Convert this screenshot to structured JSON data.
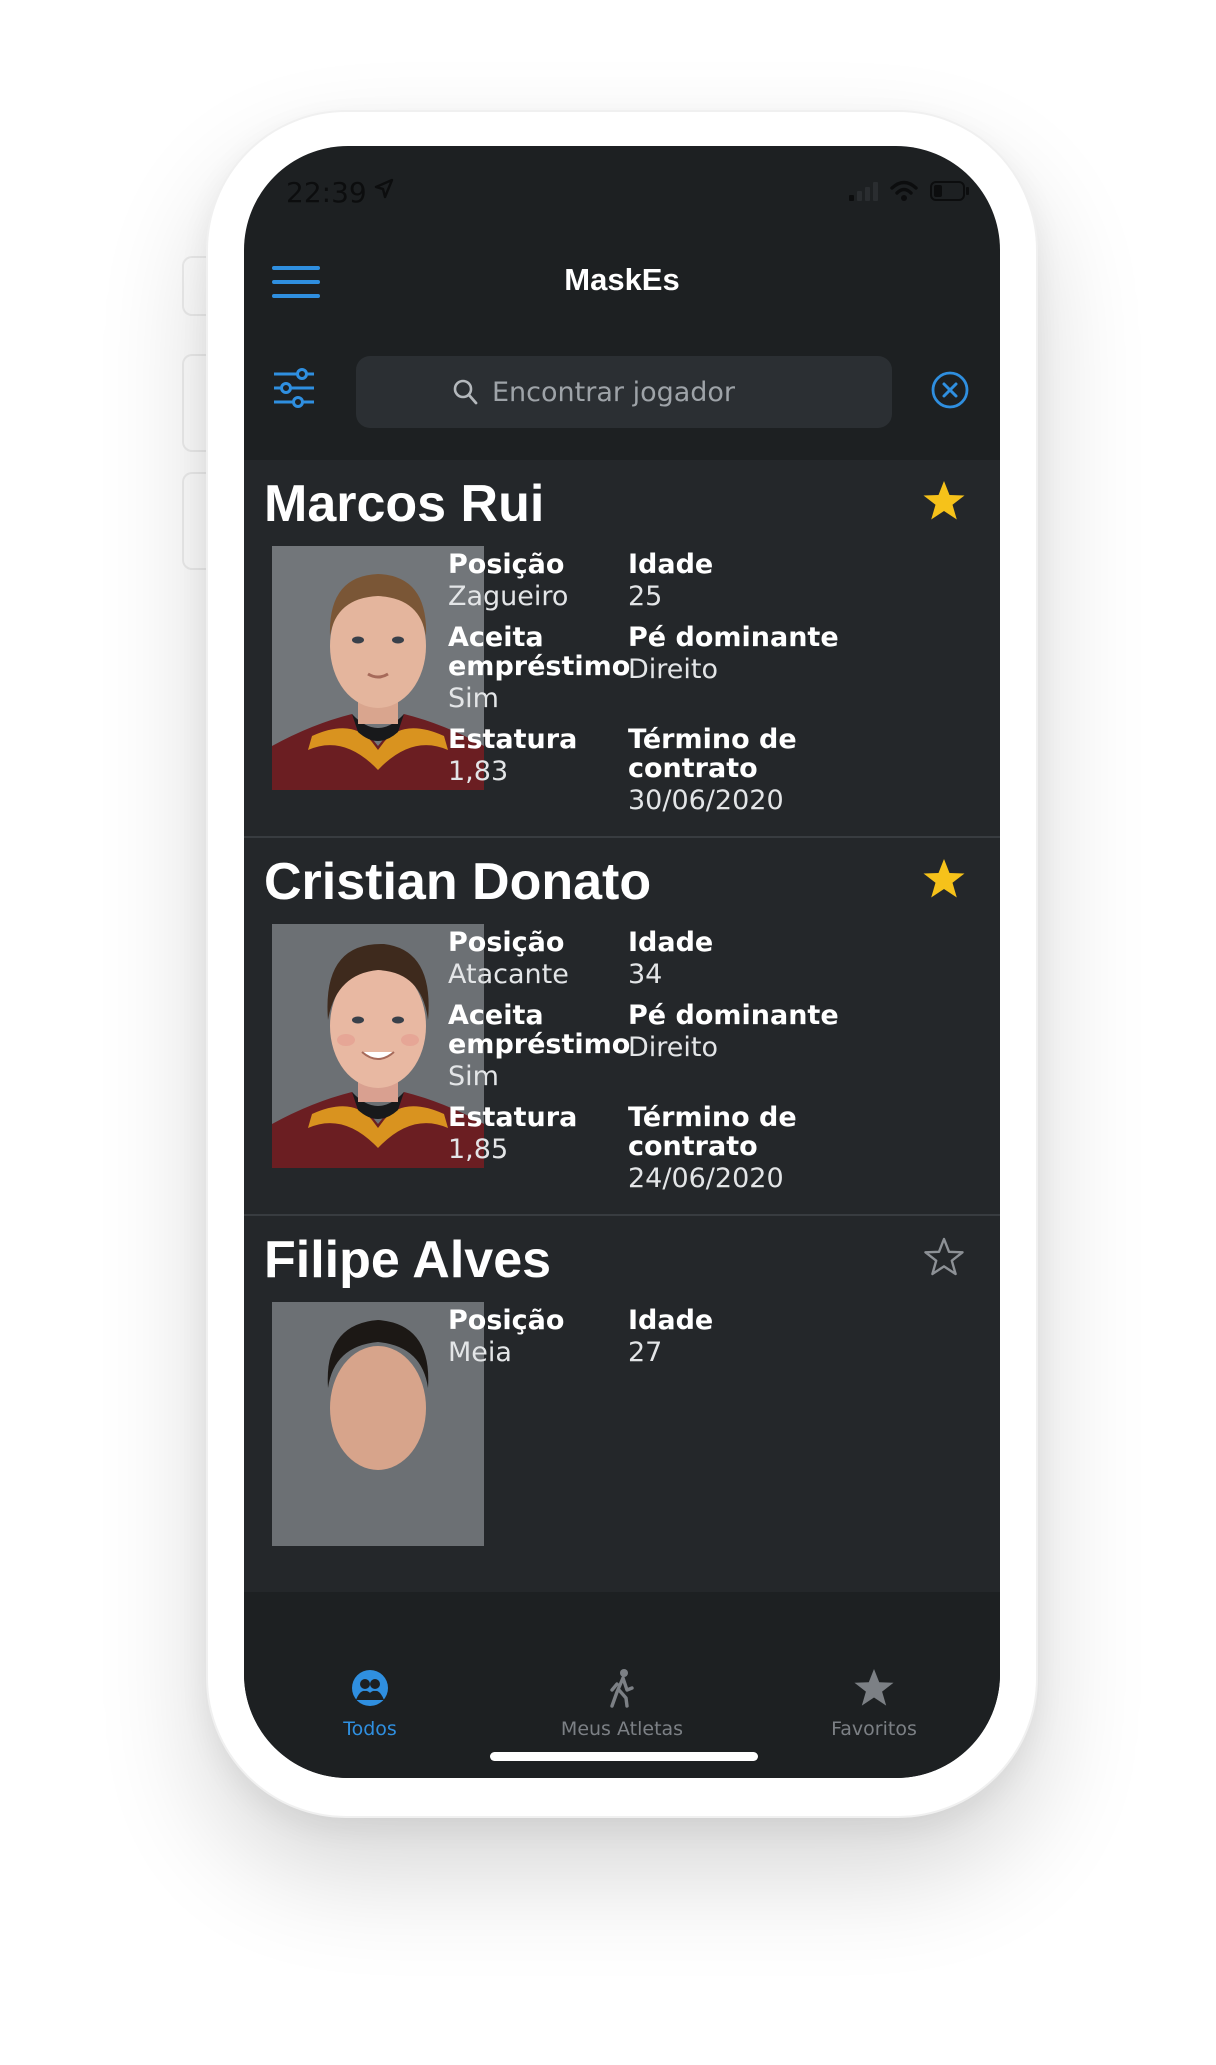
{
  "status_bar": {
    "time": "22:39"
  },
  "header": {
    "title": "MaskEs"
  },
  "search": {
    "placeholder": "Encontrar jogador"
  },
  "labels": {
    "position": "Posição",
    "age": "Idade",
    "loan_line1": "Aceita",
    "loan_line2": "empréstimo",
    "foot": "Pé dominante",
    "height": "Estatura",
    "contract_line1": "Término de",
    "contract_line2": "contrato"
  },
  "players": [
    {
      "name": "Marcos Rui",
      "favorite": true,
      "position": "Zagueiro",
      "age": "25",
      "accepts_loan": "Sim",
      "dominant_foot": "Direito",
      "height": "1,83",
      "contract_end": "30/06/2020"
    },
    {
      "name": "Cristian Donato",
      "favorite": true,
      "position": "Atacante",
      "age": "34",
      "accepts_loan": "Sim",
      "dominant_foot": "Direito",
      "height": "1,85",
      "contract_end": "24/06/2020"
    },
    {
      "name": "Filipe Alves",
      "favorite": false,
      "position": "Meia",
      "age": "27"
    }
  ],
  "tabs": [
    {
      "label": "Todos",
      "icon": "group-icon",
      "active": true
    },
    {
      "label": "Meus Atletas",
      "icon": "walking-person-icon",
      "active": false
    },
    {
      "label": "Favoritos",
      "icon": "star-icon",
      "active": false
    }
  ],
  "colors": {
    "accent": "#2f8fe0",
    "star": "#f6c21a",
    "card": "#24272a",
    "background": "#1d2022"
  }
}
